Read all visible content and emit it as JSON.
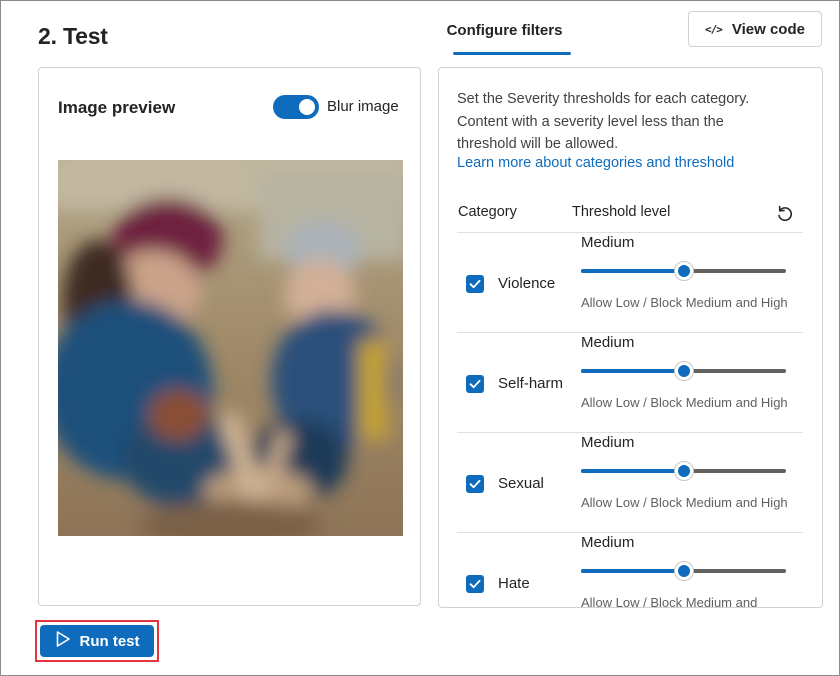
{
  "page": {
    "title": "2. Test"
  },
  "tabs": [
    {
      "label": "Configure filters",
      "selected": true
    }
  ],
  "header": {
    "view_code_label": "View code",
    "view_code_icon": "code-icon"
  },
  "image_preview": {
    "title": "Image preview",
    "blur_toggle": {
      "label": "Blur image",
      "on": true
    }
  },
  "filters": {
    "intro": "Set the Severity thresholds for each category. Content with a severity level less than the threshold will be allowed.",
    "learn_more_link": "Learn more about categories and threshold",
    "column_headers": {
      "category": "Category",
      "threshold": "Threshold level"
    },
    "reset_icon": "reset-icon",
    "rows": [
      {
        "category": "Violence",
        "checked": true,
        "level": "Medium",
        "level_fraction": 0.5,
        "description": "Allow Low / Block Medium and High"
      },
      {
        "category": "Self-harm",
        "checked": true,
        "level": "Medium",
        "level_fraction": 0.5,
        "description": "Allow Low / Block Medium and High"
      },
      {
        "category": "Sexual",
        "checked": true,
        "level": "Medium",
        "level_fraction": 0.5,
        "description": "Allow Low / Block Medium and High"
      },
      {
        "category": "Hate",
        "checked": true,
        "level": "Medium",
        "level_fraction": 0.5,
        "description": "Allow Low / Block Medium and"
      }
    ]
  },
  "run_test": {
    "label": "Run test",
    "icon": "play-icon"
  },
  "colors": {
    "accent": "#0f6cbd",
    "highlight_border": "#e5343f",
    "track": "#616161"
  }
}
